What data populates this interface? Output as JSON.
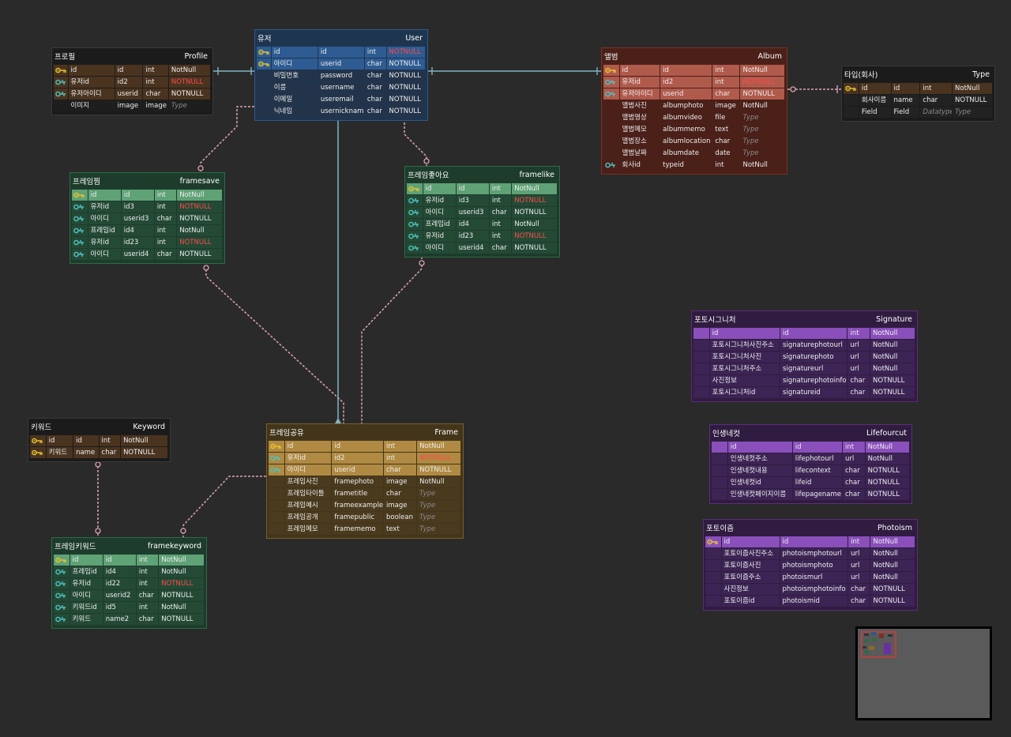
{
  "tables": {
    "profile": {
      "title_ko": "프로필",
      "title_en": "Profile",
      "rows": [
        {
          "key": "pk",
          "label": "id",
          "field": "id",
          "type": "int",
          "constraint": "NotNull"
        },
        {
          "key": "fk",
          "label": "유저id",
          "field": "id2",
          "type": "int",
          "constraint": "NOTNULL",
          "red": true
        },
        {
          "key": "fk",
          "label": "유저아이디",
          "field": "userid",
          "type": "char",
          "constraint": "NOTNULL"
        },
        {
          "key": "",
          "label": "이미지",
          "field": "image",
          "type": "image",
          "constraint": "Type",
          "ph": true
        }
      ]
    },
    "user": {
      "title_ko": "유저",
      "title_en": "User",
      "rows": [
        {
          "key": "pk",
          "label": "id",
          "field": "id",
          "type": "int",
          "constraint": "NOTNULL",
          "red": true
        },
        {
          "key": "pk",
          "label": "아이디",
          "field": "userid",
          "type": "char",
          "constraint": "NOTNULL"
        },
        {
          "key": "",
          "label": "비밀번호",
          "field": "password",
          "type": "char",
          "constraint": "NOTNULL"
        },
        {
          "key": "",
          "label": "이름",
          "field": "username",
          "type": "char",
          "constraint": "NOTNULL"
        },
        {
          "key": "",
          "label": "이메일",
          "field": "useremail",
          "type": "char",
          "constraint": "NOTNULL"
        },
        {
          "key": "",
          "label": "닉네임",
          "field": "usernickname",
          "type": "char",
          "constraint": "NOTNULL"
        }
      ]
    },
    "album": {
      "title_ko": "앨범",
      "title_en": "Album",
      "rows": [
        {
          "key": "pk",
          "label": "id",
          "field": "id",
          "type": "int",
          "constraint": "NotNull"
        },
        {
          "key": "fk",
          "label": "유저id",
          "field": "id2",
          "type": "int",
          "constraint": "NOTNULL",
          "red": true
        },
        {
          "key": "fk",
          "label": "유저아이디",
          "field": "userid",
          "type": "char",
          "constraint": "NOTNULL"
        },
        {
          "key": "",
          "label": "앨범사진",
          "field": "albumphoto",
          "type": "image",
          "constraint": "NotNull"
        },
        {
          "key": "",
          "label": "앨범영상",
          "field": "albumvideo",
          "type": "file",
          "constraint": "Type",
          "ph": true
        },
        {
          "key": "",
          "label": "앨범메모",
          "field": "albummemo",
          "type": "text",
          "constraint": "Type",
          "ph": true
        },
        {
          "key": "",
          "label": "앨범장소",
          "field": "albumlocation",
          "type": "char",
          "constraint": "Type",
          "ph": true
        },
        {
          "key": "",
          "label": "앨범날짜",
          "field": "albumdate",
          "type": "date",
          "constraint": "Type",
          "ph": true
        },
        {
          "key": "fk",
          "label": "회사id",
          "field": "typeid",
          "type": "int",
          "constraint": "NotNull"
        }
      ]
    },
    "type": {
      "title_ko": "타입(회사)",
      "title_en": "Type",
      "rows": [
        {
          "key": "pk",
          "label": "id",
          "field": "id",
          "type": "int",
          "constraint": "NotNull"
        },
        {
          "key": "",
          "label": "회사이름",
          "field": "name",
          "type": "char",
          "constraint": "NOTNULL"
        },
        {
          "key": "",
          "label": "Field",
          "field": "Field",
          "type": "Datatype",
          "constraint": "Type",
          "ph": true,
          "phType": true
        }
      ]
    },
    "framesave": {
      "title_ko": "프레임찜",
      "title_en": "framesave",
      "rows": [
        {
          "key": "pk",
          "label": "id",
          "field": "id",
          "type": "int",
          "constraint": "NotNull"
        },
        {
          "key": "fk",
          "label": "유저id",
          "field": "id3",
          "type": "int",
          "constraint": "NOTNULL",
          "red": true
        },
        {
          "key": "fk",
          "label": "아이디",
          "field": "userid3",
          "type": "char",
          "constraint": "NOTNULL"
        },
        {
          "key": "fk",
          "label": "프레임id",
          "field": "id4",
          "type": "int",
          "constraint": "NotNull"
        },
        {
          "key": "fk",
          "label": "유저id",
          "field": "id23",
          "type": "int",
          "constraint": "NOTNULL",
          "red": true
        },
        {
          "key": "fk",
          "label": "아이디",
          "field": "userid4",
          "type": "char",
          "constraint": "NOTNULL"
        }
      ]
    },
    "framelike": {
      "title_ko": "프레임좋아요",
      "title_en": "framelike",
      "rows": [
        {
          "key": "pk",
          "label": "id",
          "field": "id",
          "type": "int",
          "constraint": "NotNull"
        },
        {
          "key": "fk",
          "label": "유저id",
          "field": "id3",
          "type": "int",
          "constraint": "NOTNULL",
          "red": true
        },
        {
          "key": "fk",
          "label": "아이디",
          "field": "userid3",
          "type": "char",
          "constraint": "NOTNULL"
        },
        {
          "key": "fk",
          "label": "프레임id",
          "field": "id4",
          "type": "int",
          "constraint": "NotNull"
        },
        {
          "key": "fk",
          "label": "유저id",
          "field": "id23",
          "type": "int",
          "constraint": "NOTNULL",
          "red": true
        },
        {
          "key": "fk",
          "label": "아이디",
          "field": "userid4",
          "type": "char",
          "constraint": "NOTNULL"
        }
      ]
    },
    "signature": {
      "title_ko": "포토시그니처",
      "title_en": "Signature",
      "rows": [
        {
          "key": "",
          "label": "id",
          "field": "id",
          "type": "int",
          "constraint": "NotNull"
        },
        {
          "key": "",
          "label": "포토시그니처사진주소",
          "field": "signaturephotourl",
          "type": "url",
          "constraint": "NotNull"
        },
        {
          "key": "",
          "label": "포토시그니처사진",
          "field": "signaturephoto",
          "type": "url",
          "constraint": "NotNull"
        },
        {
          "key": "",
          "label": "포토시그니처주소",
          "field": "signatureurl",
          "type": "url",
          "constraint": "NotNull"
        },
        {
          "key": "",
          "label": "사진정보",
          "field": "signaturephotoinfo",
          "type": "char",
          "constraint": "NOTNULL"
        },
        {
          "key": "",
          "label": "포토시그니처id",
          "field": "signatureid",
          "type": "char",
          "constraint": "NOTNULL"
        }
      ]
    },
    "lifefourcut": {
      "title_ko": "인생네컷",
      "title_en": "Lifefourcut",
      "rows": [
        {
          "key": "",
          "label": "id",
          "field": "id",
          "type": "int",
          "constraint": "NotNull"
        },
        {
          "key": "",
          "label": "인생네컷주소",
          "field": "lifephotourl",
          "type": "url",
          "constraint": "NotNull"
        },
        {
          "key": "",
          "label": "인생네컷내용",
          "field": "lifecontext",
          "type": "char",
          "constraint": "NOTNULL"
        },
        {
          "key": "",
          "label": "인생네컷id",
          "field": "lifeid",
          "type": "char",
          "constraint": "NOTNULL"
        },
        {
          "key": "",
          "label": "인생네컷페이지이름",
          "field": "lifepagename",
          "type": "char",
          "constraint": "NOTNULL"
        }
      ]
    },
    "keyword": {
      "title_ko": "키워드",
      "title_en": "Keyword",
      "rows": [
        {
          "key": "pk",
          "label": "id",
          "field": "id",
          "type": "int",
          "constraint": "NotNull"
        },
        {
          "key": "pk",
          "label": "키워드",
          "field": "name",
          "type": "char",
          "constraint": "NOTNULL"
        }
      ]
    },
    "frame": {
      "title_ko": "프레임공유",
      "title_en": "Frame",
      "rows": [
        {
          "key": "pk",
          "label": "id",
          "field": "id",
          "type": "int",
          "constraint": "NotNull"
        },
        {
          "key": "fk",
          "label": "유저id",
          "field": "id2",
          "type": "int",
          "constraint": "NOTNULL",
          "red": true
        },
        {
          "key": "fk",
          "label": "아이디",
          "field": "userid",
          "type": "char",
          "constraint": "NOTNULL"
        },
        {
          "key": "",
          "label": "프레임사진",
          "field": "framephoto",
          "type": "image",
          "constraint": "NotNull"
        },
        {
          "key": "",
          "label": "프레임타이틀",
          "field": "frametitle",
          "type": "char",
          "constraint": "Type",
          "ph": true
        },
        {
          "key": "",
          "label": "프레임예시",
          "field": "frameexample",
          "type": "image",
          "constraint": "Type",
          "ph": true
        },
        {
          "key": "",
          "label": "프레임공개",
          "field": "framepublic",
          "type": "boolean",
          "constraint": "Type",
          "ph": true
        },
        {
          "key": "",
          "label": "프레임메모",
          "field": "framememo",
          "type": "text",
          "constraint": "Type",
          "ph": true
        }
      ]
    },
    "photoism": {
      "title_ko": "포토이즘",
      "title_en": "Photoism",
      "rows": [
        {
          "key": "pk",
          "label": "id",
          "field": "id",
          "type": "int",
          "constraint": "NotNull"
        },
        {
          "key": "",
          "label": "포토이즘사진주소",
          "field": "photoismphotourl",
          "type": "url",
          "constraint": "NotNull"
        },
        {
          "key": "",
          "label": "포토이즘사진",
          "field": "photoismphoto",
          "type": "url",
          "constraint": "NotNull"
        },
        {
          "key": "",
          "label": "포토이즘주소",
          "field": "photoismurl",
          "type": "url",
          "constraint": "NotNull"
        },
        {
          "key": "",
          "label": "사진정보",
          "field": "photoismphotoinfo",
          "type": "char",
          "constraint": "NOTNULL"
        },
        {
          "key": "",
          "label": "포토이즘id",
          "field": "photoismid",
          "type": "char",
          "constraint": "NOTNULL"
        }
      ]
    },
    "framekeyword": {
      "title_ko": "프레임키워드",
      "title_en": "framekeyword",
      "rows": [
        {
          "key": "pk",
          "label": "id",
          "field": "id",
          "type": "int",
          "constraint": "NotNull"
        },
        {
          "key": "fk",
          "label": "프레임id",
          "field": "id4",
          "type": "int",
          "constraint": "NotNull"
        },
        {
          "key": "fk",
          "label": "유저id",
          "field": "id22",
          "type": "int",
          "constraint": "NOTNULL",
          "red": true
        },
        {
          "key": "fk",
          "label": "아이디",
          "field": "userid2",
          "type": "char",
          "constraint": "NOTNULL"
        },
        {
          "key": "fk",
          "label": "키워드id",
          "field": "id5",
          "type": "int",
          "constraint": "NotNull"
        },
        {
          "key": "fk",
          "label": "키워드",
          "field": "name2",
          "type": "char",
          "constraint": "NOTNULL"
        }
      ]
    }
  },
  "theme": {
    "canvas_bg": "#2a2a2a",
    "link_solid": "#7fb3c4",
    "link_dashed": "#d9a3b1",
    "pk_icon": "#e6c230",
    "fk_icon": "#4fc3c3"
  },
  "icons": {
    "primary_key": "key-icon",
    "foreign_key": "link-icon"
  }
}
